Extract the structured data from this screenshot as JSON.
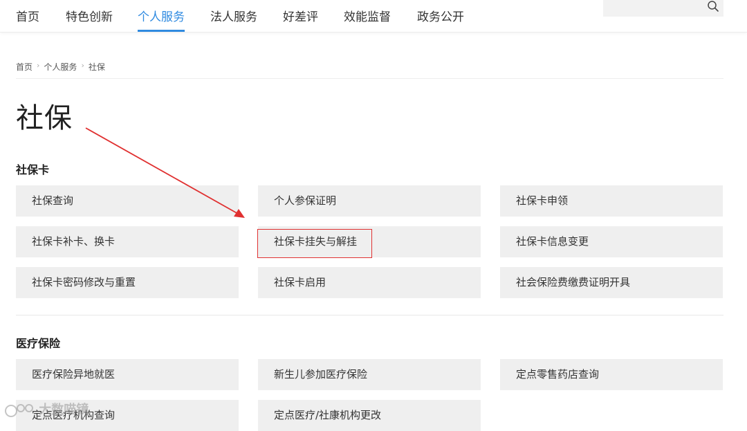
{
  "nav": {
    "items": [
      {
        "label": "首页"
      },
      {
        "label": "特色创新"
      },
      {
        "label": "个人服务"
      },
      {
        "label": "法人服务"
      },
      {
        "label": "好差评"
      },
      {
        "label": "效能监督"
      },
      {
        "label": "政务公开"
      }
    ],
    "active_index": 2,
    "search": {
      "placeholder": "",
      "icon": "search-icon"
    }
  },
  "breadcrumb": [
    "首页",
    "个人服务",
    "社保"
  ],
  "page_title": "社保",
  "sections": [
    {
      "title": "社保卡",
      "items": [
        "社保查询",
        "个人参保证明",
        "社保卡申领",
        "社保卡补卡、换卡",
        "社保卡挂失与解挂",
        "社保卡信息变更",
        "社保卡密码修改与重置",
        "社保卡启用",
        "社会保险费缴费证明开具"
      ]
    },
    {
      "title": "医疗保险",
      "items": [
        "医疗保险异地就医",
        "新生儿参加医疗保险",
        "定点零售药店查询",
        "定点医疗机构查询",
        "定点医疗/社康机构更改"
      ]
    }
  ],
  "annotation": {
    "highlighted_item": "社保卡挂失与解挂",
    "color": "#e03030"
  },
  "watermark": "大数喵镜",
  "colors": {
    "accent": "#2f8ae0",
    "tile_bg": "#efefef",
    "annotation_red": "#e03030"
  }
}
